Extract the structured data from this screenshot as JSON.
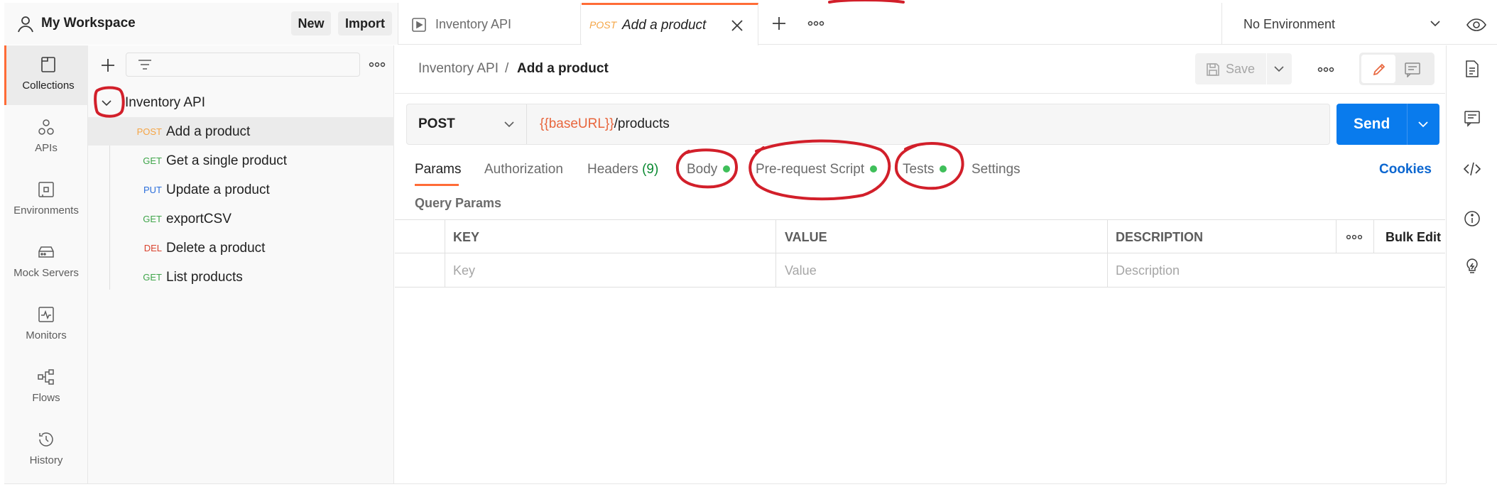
{
  "header": {
    "workspace_name": "My Workspace",
    "new_label": "New",
    "import_label": "Import",
    "tabs": [
      {
        "label": "Inventory API",
        "method": ""
      },
      {
        "label": "Add a product",
        "method": "POST"
      }
    ],
    "environment": "No Environment"
  },
  "rail": {
    "items": [
      {
        "label": "Collections"
      },
      {
        "label": "APIs"
      },
      {
        "label": "Environments"
      },
      {
        "label": "Mock Servers"
      },
      {
        "label": "Monitors"
      },
      {
        "label": "Flows"
      },
      {
        "label": "History"
      }
    ]
  },
  "sidebar": {
    "collection_name": "Inventory API",
    "requests": [
      {
        "method": "POST",
        "name": "Add a product",
        "color": "#f5a545"
      },
      {
        "method": "GET",
        "name": "Get a single product",
        "color": "#3fa54a"
      },
      {
        "method": "PUT",
        "name": "Update a product",
        "color": "#2c6fdb"
      },
      {
        "method": "GET",
        "name": "exportCSV",
        "color": "#3fa54a"
      },
      {
        "method": "DEL",
        "name": "Delete a product",
        "color": "#d9432e"
      },
      {
        "method": "GET",
        "name": "List products",
        "color": "#3fa54a"
      }
    ]
  },
  "request": {
    "breadcrumb_parent": "Inventory API",
    "breadcrumb_sep": "/",
    "breadcrumb_current": "Add a product",
    "save_label": "Save",
    "method": "POST",
    "url_var": "{{baseURL}}",
    "url_path": "/products",
    "send_label": "Send",
    "tabs": {
      "params": "Params",
      "authorization": "Authorization",
      "headers": "Headers",
      "headers_count": "(9)",
      "body": "Body",
      "prerequest": "Pre-request Script",
      "tests": "Tests",
      "settings": "Settings"
    },
    "cookies_label": "Cookies",
    "query_params_label": "Query Params",
    "table": {
      "headers": {
        "key": "KEY",
        "value": "VALUE",
        "description": "DESCRIPTION"
      },
      "bulk_edit": "Bulk Edit",
      "placeholders": {
        "key": "Key",
        "value": "Value",
        "description": "Description"
      }
    }
  },
  "colors": {
    "accent": "#ff6c37",
    "send": "#097bed",
    "annotation": "#d21f2a",
    "status_dot": "#3fbf5a"
  }
}
